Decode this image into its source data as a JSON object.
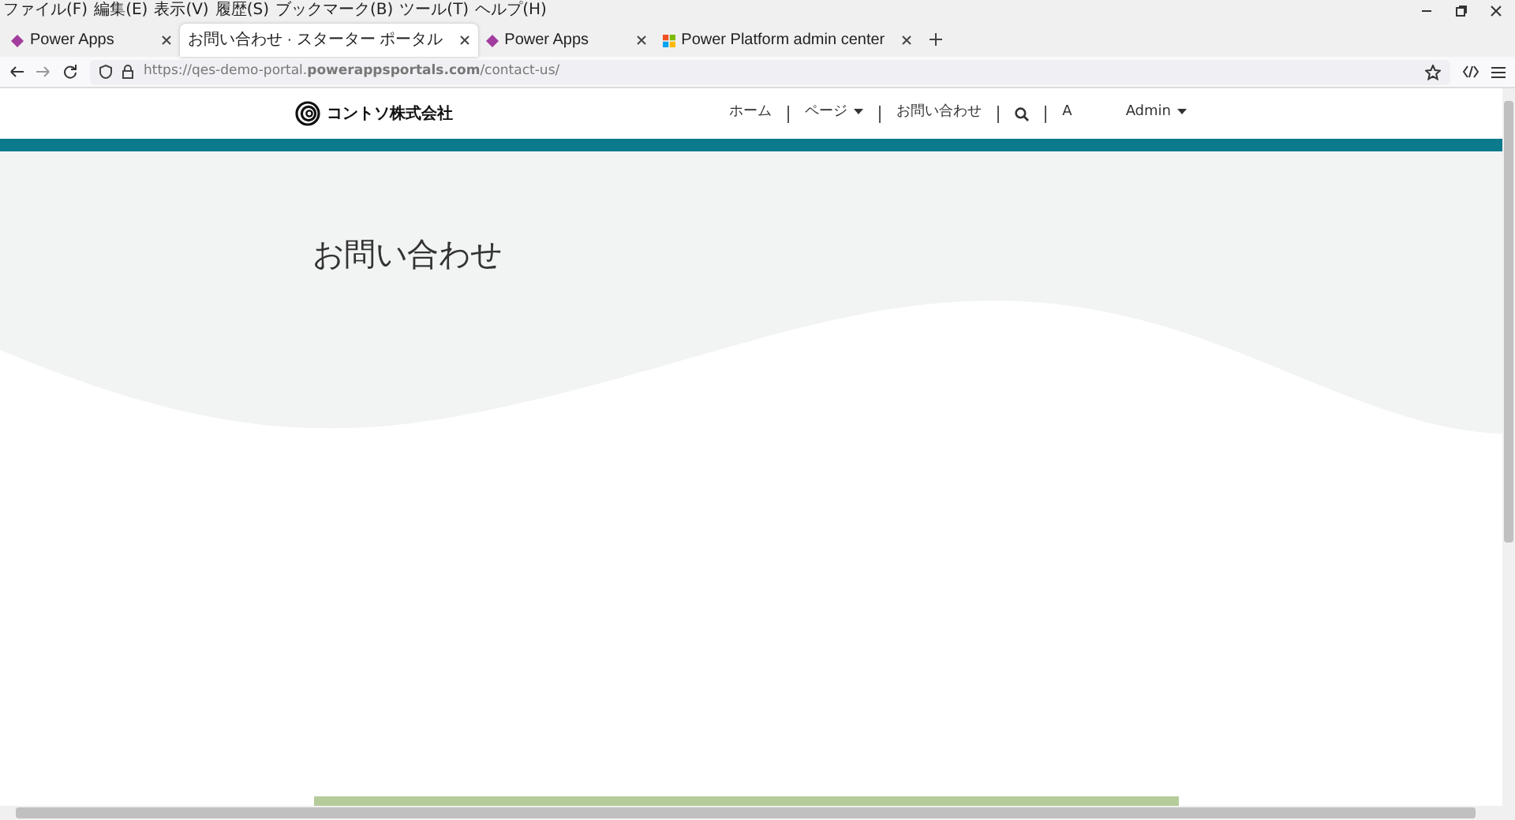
{
  "menu_bar": [
    "ファイル(F)",
    "編集(E)",
    "表示(V)",
    "履歴(S)",
    "ブックマーク(B)",
    "ツール(T)",
    "ヘルプ(H)"
  ],
  "tabs": [
    {
      "title": "Power Apps",
      "selected": false,
      "kind": "diamond"
    },
    {
      "title": "お問い合わせ · スターター ポータル",
      "selected": true,
      "kind": "plain"
    },
    {
      "title": "Power Apps",
      "selected": false,
      "kind": "diamond"
    },
    {
      "title": "Power Platform admin center",
      "selected": false,
      "kind": "grid"
    }
  ],
  "address_bar": {
    "url": "https://qes-demo-portal.**powerappsportals.com**/contact-us/"
  },
  "site_header": {
    "brand": "コントソ株式会社",
    "nav": [
      {
        "kind": "link",
        "label": "ホーム"
      },
      {
        "kind": "dropdown",
        "label": "ページ"
      },
      {
        "kind": "link",
        "label": "お問い合わせ"
      },
      {
        "kind": "search"
      },
      {
        "kind": "link",
        "label": "A"
      },
      {
        "kind": "dropdown",
        "label": "Admin"
      }
    ]
  },
  "page": {
    "title": "お問い合わせ"
  }
}
